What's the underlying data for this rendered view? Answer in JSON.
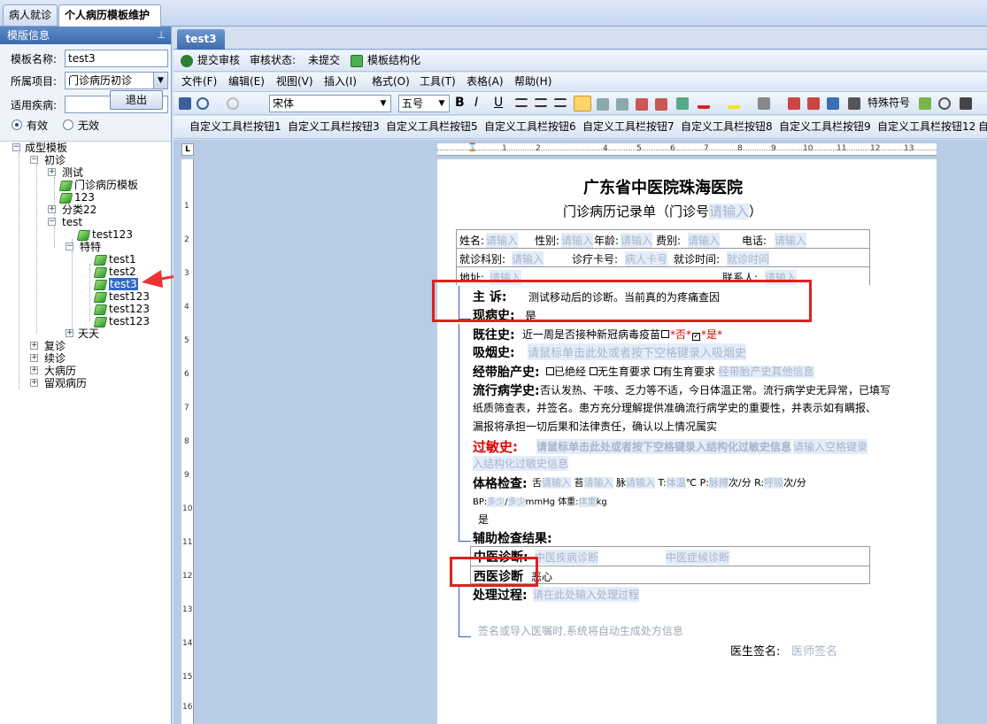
{
  "top_tabs": [
    "病人就诊",
    "个人病历模板维护"
  ],
  "left": {
    "header": "模版信息",
    "template_name_label": "模板名称:",
    "template_name_value": "test3",
    "project_label": "所属项目:",
    "project_value": "门诊病历初诊",
    "disease_label": "适用疾病:",
    "disease_value": "",
    "valid_label": "有效",
    "invalid_label": "无效",
    "exit_label": "退出",
    "tree": {
      "root": "成型模板",
      "chuzhen": "初诊",
      "ceshi": "测试",
      "mz_template": "门诊病历模板",
      "n123": "123",
      "fenlei": "分类22",
      "test": "test",
      "test123a": "test123",
      "tete": "特特",
      "t1": "test1",
      "t2": "test2",
      "t3": "test3",
      "t4": "test123",
      "t5": "test123",
      "t6": "test123",
      "tiantian": "天天",
      "fuzhen": "复诊",
      "xuzhen": "续诊",
      "dabingli": "大病历",
      "liuguan": "留观病历"
    }
  },
  "doc_tab": "test3",
  "audit_bar": {
    "submit": "提交审核",
    "status_label": "审核状态:",
    "status_value": "未提交",
    "structure": "模板结构化"
  },
  "menu": [
    "文件(F)",
    "编辑(E)",
    "视图(V)",
    "插入(I)",
    "格式(O)",
    "工具(T)",
    "表格(A)",
    "帮助(H)"
  ],
  "format_bar": {
    "font": "宋体",
    "size": "五号",
    "bold": "B",
    "italic": "I",
    "underline": "U",
    "special": "特殊符号"
  },
  "custom_buttons": [
    "自定义工具栏按钮1",
    "自定义工具栏按钮3",
    "自定义工具栏按钮5",
    "自定义工具栏按钮6",
    "自定义工具栏按钮7",
    "自定义工具栏按钮8",
    "自定义工具栏按钮9",
    "自定义工具栏按钮12",
    "自"
  ],
  "ruler_numbers_top": [
    "1",
    "2",
    "4",
    "5",
    "6",
    "7",
    "8",
    "9",
    "10",
    "11",
    "12",
    "13"
  ],
  "ruler_numbers_left": [
    "1",
    "2",
    "3",
    "4",
    "5",
    "6",
    "7",
    "8",
    "9",
    "10",
    "11",
    "12",
    "13",
    "14",
    "15",
    "16"
  ],
  "ruler_corner": "L",
  "doc": {
    "hospital": "广东省中医院珠海医院",
    "subtitle_a": "门诊病历记录单（门诊号",
    "subtitle_field": "请输入",
    "subtitle_b": "）",
    "row1": {
      "name_l": "姓名:",
      "name_v": "请输入",
      "sex_l": "性别:",
      "sex_v": "请输入",
      "age_l": "年龄:",
      "age_v": "请输入",
      "fee_l": "费别:",
      "fee_v": "请输入",
      "tel_l": "电话:",
      "tel_v": "请输入"
    },
    "row2": {
      "dept_l": "就诊科别:",
      "dept_v": "请输入",
      "card_l": "诊疗卡号:",
      "card_v": "病人卡号",
      "time_l": "就诊时间:",
      "time_v": "就诊时间"
    },
    "row3": {
      "addr_l": "地址:",
      "addr_v": "请输入",
      "contact_l": "联系人:",
      "contact_v": "请输入"
    },
    "complaint_l": "主   诉:",
    "complaint_v": "测试移动后的诊断。当前真的为疼痛查因",
    "present_l": "现病史:",
    "present_v": "是",
    "past_l": "既往史:",
    "past_v": "近一周是否接种新冠病毒疫苗",
    "past_no": "*否*",
    "past_yes": "*是*",
    "smoke_l": "吸烟史:",
    "smoke_v": "请鼠标单击此处或者按下空格键录入吸烟史",
    "menses_l": "经带胎产史:",
    "menses_o1": "已绝经",
    "menses_o2": "无生育要求",
    "menses_o3": "有生育要求",
    "menses_v": "经带胎产史其他信息",
    "epi_l": "流行病学史:",
    "epi_line1": "否认发热、干咳、乏力等不适，今日体温正常。流行病学史无异常，已填写",
    "epi_line2": "纸质筛查表，并签名。患方充分理解提供准确流行病学史的重要性，并表示如有瞒报、",
    "epi_line3": "漏报将承担一切后果和法律责任，确认以上情况属实",
    "allergy_l": "过敏史:",
    "allergy_v1": "请鼠标单击此处或者按下空格键录入结构化过敏史信息",
    "allergy_v2": "请输入空格键录",
    "allergy_v3": "入结构化过敏史信息",
    "exam_l": "体格检查:",
    "tongue_l": "舌",
    "tongue_v": "请输入",
    "coat_l": "苔",
    "coat_v": "请输入",
    "pulse_l": "脉",
    "pulse_v": "请输入",
    "t_l": "T:",
    "t_v": "体温",
    "t_u": "℃",
    "p_l": "P:",
    "p_v": "脉搏",
    "p_u": "次/分",
    "r_l": "R:",
    "r_v": "呼吸",
    "r_u": "次/分",
    "bp_l": "BP:",
    "bp_v1": "多少",
    "bp_sep": "/",
    "bp_v2": "多少",
    "bp_u": "mmHg",
    "wt_l": "体重:",
    "wt_v": "体重",
    "wt_u": "kg",
    "exam_yes": "是",
    "aux_l": "辅助检查结果:",
    "tcm_l": "中医诊断:",
    "tcm_v1": "中医疾病诊断",
    "tcm_v2": "中医症候诊断",
    "west_l": "西医诊断",
    "west_v": "恶心",
    "treat_l": "处理过程:",
    "treat_v": "请在此处输入处理过程",
    "sign_hint": "签名或导入医嘱时,系统将自动生成处方信息",
    "doctor_l": "医生签名:",
    "doctor_v": "医师签名"
  }
}
